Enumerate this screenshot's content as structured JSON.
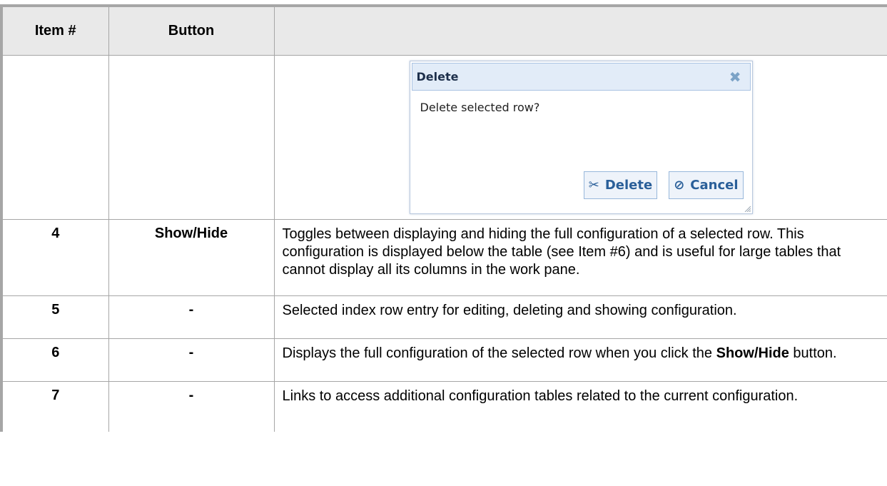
{
  "table": {
    "headers": [
      "Item #",
      "Button",
      ""
    ],
    "rows": [
      {
        "item": "",
        "button": "",
        "description": ""
      },
      {
        "item": "4",
        "button": "Show/Hide",
        "description": "Toggles between displaying and hiding the full configuration of a selected row. This configuration is displayed below the table (see Item #6) and is useful for large tables that cannot display all its columns in the work pane."
      },
      {
        "item": "5",
        "button": "-",
        "description": "Selected index row entry for editing, deleting and showing configuration."
      },
      {
        "item": "6",
        "button": "-",
        "description_pre": "Displays the full configuration of the selected row when you click the ",
        "description_bold": "Show/Hide",
        "description_post": " button."
      },
      {
        "item": "7",
        "button": "-",
        "description": "Links to access additional configuration tables related to the current configuration."
      }
    ]
  },
  "dialog": {
    "title": "Delete",
    "close_icon": "close-icon",
    "message": "Delete selected row?",
    "delete_label": "Delete",
    "delete_icon": "scissors-icon",
    "cancel_label": "Cancel",
    "cancel_icon": "cancel-icon"
  }
}
